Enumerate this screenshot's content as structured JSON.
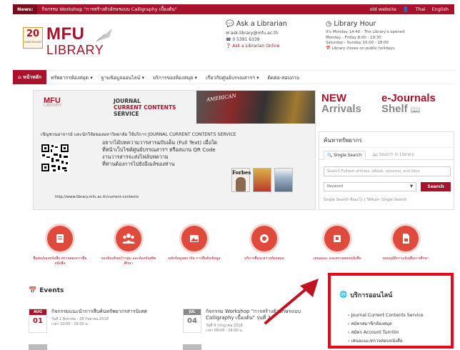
{
  "news": {
    "label": "News:",
    "text": "กิจกรรม Workshop \"การสร้างตัวอักษรแบบ Calligraphy เบื้องต้น\"",
    "links": [
      "old website",
      "Thai",
      "English"
    ]
  },
  "header": {
    "logo_number": "20",
    "logo_small": "ANNIVERSARY",
    "logo_mfu": "MFU",
    "logo_library": "LIBRARY",
    "ask": {
      "title": "Ask a Librarian",
      "email": "ask.library@mfu.ac.th",
      "phone": "0 5391 6339",
      "online": "Ask a Librarian Online"
    },
    "hours": {
      "title": "Library Hour",
      "status": "It's Monday 14:40 - The Library's opened",
      "weekday": "Monday - Friday        8:00 - 19:30",
      "weekend": "Saturday - Sunday      10:00 - 18:00",
      "holiday": "Library closes on public holidays."
    }
  },
  "nav": {
    "home": "หน้าหลัก",
    "items": [
      "ทรัพยากรห้องสมุด ▾",
      "ฐานข้อมูลออนไลน์ ▾",
      "บริการของห้องสมุด ▾",
      "เกี่ยวกับศูนย์บรรณสารฯ ▾",
      "ติดต่อ-สอบถาม"
    ]
  },
  "banner": {
    "logo": "MFU",
    "logo_sub": "LIBRARY",
    "title_lines": [
      "JOURNAL",
      "CURRENT CONTENTS",
      "SERVICE"
    ],
    "mag_cover": "AMERICAN",
    "intro": "เชิญชวนอาจารย์ และนักวิจัยของมหาวิทยาลัย ใช้บริการ JOURNAL CURRENT CONTENTS SERVICE",
    "body_lines": [
      "อยากได้บทความวารสารฉบับเต็ม (Full Text) เมื่อใด",
      "ที่หน้าเว็บไซต์ศูนย์บรรณสารฯ หรือสแกน QR Code",
      "งานวารสารจะส่งไฟล์บทความ",
      "ที่ท่านต้องการไปยังอีเมล์ของท่าน"
    ],
    "url": "http://www.library.mfu.ac.th/current-contents",
    "mag_label": "Forbes"
  },
  "promo": {
    "new_1": "NEW",
    "new_2": "Arrivals",
    "ej_1": "e-Journals",
    "ej_2": "Shelf"
  },
  "search": {
    "title": "ค้นหาทรัพยากร",
    "tab_single": "Single Search",
    "tab_library": "Search in Library",
    "placeholder": "Search Fulltext articles, eBook, eJournal, and libra",
    "select_value": "Keyword",
    "button": "Search",
    "help": "Single Search คืออะไร | วิธีค้นหา Single Search"
  },
  "services": [
    {
      "label": "ยืมต่อ/จองหนังสือ ตรวจสอบการยืมหนังสือ"
    },
    {
      "label": "จองห้องค้นคว้ากลุ่ม และห้องบัณฑิตศึกษา"
    },
    {
      "label": "คลังข้อมูลสถาบัน การสืบค้นข้อมูล"
    },
    {
      "label": "บริการยืมระหว่างห้องสมุด"
    },
    {
      "label": "เสนอแนะ และตรวจสอบหนังสือ"
    },
    {
      "label": "ขออนุมัติการแจ้งเพื่อการศึกษา"
    }
  ],
  "events": {
    "heading": "Events",
    "items": [
      {
        "month": "AUG",
        "day": "01",
        "title": "กิจกรรมแนะนำการสืบค้นทรัพยากรสารนิเทศ",
        "date": "วันที่ 1 สิงหาคม - 28 กันยายน 2018",
        "time": "เวลา 10:00 - 15:00 น."
      },
      {
        "month": "JUL",
        "day": "04",
        "title": "กิจกรรม Workshop \"การสร้างตัวอักษรแบบ Calligraphy เบื้องต้น\" รุ่นที่ 2",
        "date": "วันที่ 4 กรกฎาคม 2018",
        "time": "เวลา 09:00 - 16:00 น."
      }
    ]
  },
  "online_services": {
    "title": "บริการออนไลน์",
    "items": [
      "Journal Current Contents Service",
      "สมัครสมาชิกห้องสมุด",
      "สมัคร Account Turnitin",
      "เสนอแนะ/ตรวจสอบหนังสือ"
    ]
  }
}
